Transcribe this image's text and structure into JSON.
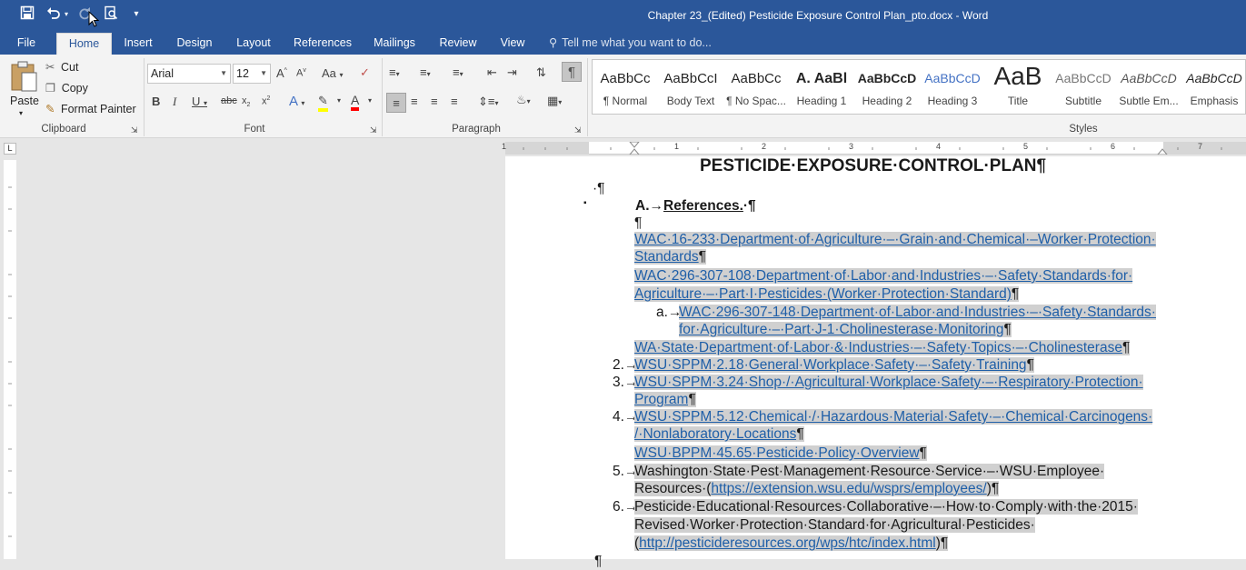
{
  "window": {
    "title": "Chapter 23_(Edited) Pesticide Exposure Control Plan_pto.docx - Word"
  },
  "quick_access": {
    "save": "save-icon",
    "undo": "undo-icon",
    "redo": "redo-icon",
    "print_preview": "print-preview-icon",
    "customize": "▾"
  },
  "tabs": [
    "File",
    "Home",
    "Insert",
    "Design",
    "Layout",
    "References",
    "Mailings",
    "Review",
    "View"
  ],
  "tell_me": "Tell me what you want to do...",
  "clipboard": {
    "paste": "Paste",
    "cut": "Cut",
    "copy": "Copy",
    "format_painter": "Format Painter",
    "label": "Clipboard"
  },
  "font": {
    "name": "Arial",
    "size": "12",
    "label": "Font",
    "case": "Aa"
  },
  "paragraph": {
    "label": "Paragraph"
  },
  "styles": {
    "label": "Styles",
    "items": [
      {
        "sample": "AaBbCc",
        "name": "¶ Normal"
      },
      {
        "sample": "AaBbCcI",
        "name": "Body Text"
      },
      {
        "sample": "AaBbCc",
        "name": "¶ No Spac..."
      },
      {
        "sample": "A. AaBl",
        "name": "Heading 1"
      },
      {
        "sample": "AaBbCcD",
        "name": "Heading 2"
      },
      {
        "sample": "AaBbCcD",
        "name": "Heading 3"
      },
      {
        "sample": "AaB",
        "name": "Title"
      },
      {
        "sample": "AaBbCcD",
        "name": "Subtitle"
      },
      {
        "sample": "AaBbCcD",
        "name": "Subtle Em..."
      },
      {
        "sample": "AaBbCcD",
        "name": "Emphasis"
      }
    ]
  },
  "ruler": {
    "marks": [
      "1",
      "1",
      "2",
      "3",
      "4",
      "5",
      "6",
      "7"
    ]
  },
  "document": {
    "heading": "PESTICIDE·EXPOSURE·CONTROL·PLAN¶",
    "pilcrow1": "·¶",
    "section_a": "A.→",
    "section_a_title": "References.",
    "section_a_tail": "·¶",
    "pilcrow2": "¶",
    "ref1_l1": "WAC·16-233·Department·of·Agriculture·–·Grain·and·Chemical·–Worker·Protection·",
    "ref1_l2": "Standards",
    "ref2_l1": "WAC·296-307-108·Department·of·Labor·and·Industries·–·Safety·Standards·for·",
    "ref2_l2": "Agriculture·–·Part·I·Pesticides·(Worker·Protection·Standard)",
    "sub_a": "a.→",
    "ref3_l1": "WAC·296-307-148·Department·of·Labor·and·Industries·–·Safety·Standards·",
    "ref3_l2": "for·Agriculture·–·Part·J-1·Cholinesterase·Monitoring",
    "ref4": "WA·State·Department·of·Labor·&·Industries·–·Safety·Topics·–·Cholinesterase",
    "n2": "2.→",
    "ref5": "WSU·SPPM·2.18·General·Workplace·Safety·–·Safety·Training",
    "n3": "3.→",
    "ref6_l1": "WSU·SPPM·3.24·Shop·/·Agricultural·Workplace·Safety·–·Respiratory·Protection·",
    "ref6_l2": "Program",
    "n4": "4.→",
    "ref7_l1": "WSU·SPPM·5.12·Chemical·/·Hazardous·Material·Safety·–·Chemical·Carcinogens·",
    "ref7_l2": "/·Nonlaboratory·Locations",
    "ref8": "WSU·BPPM·45.65·Pesticide·Policy·Overview",
    "n5": "5.→",
    "ref9_l1": "Washington·State·Pest·Management·Resource·Service·–·WSU·Employee·",
    "ref9_l2a": "Resources·(",
    "ref9_link": "https://extension.wsu.edu/wsprs/employees/",
    "ref9_l2b": ")¶",
    "n6": "6.→",
    "ref10_l1": "Pesticide·Educational·Resources·Collaborative·–·How·to·Comply·with·the·2015·",
    "ref10_l2": "Revised·Worker·Protection·Standard·for·Agricultural·Pesticides·",
    "ref10_l3a": "(",
    "ref10_link": "http://pesticideresources.org/wps/htc/index.html",
    "ref10_l3b": ")¶",
    "pil": "¶"
  }
}
